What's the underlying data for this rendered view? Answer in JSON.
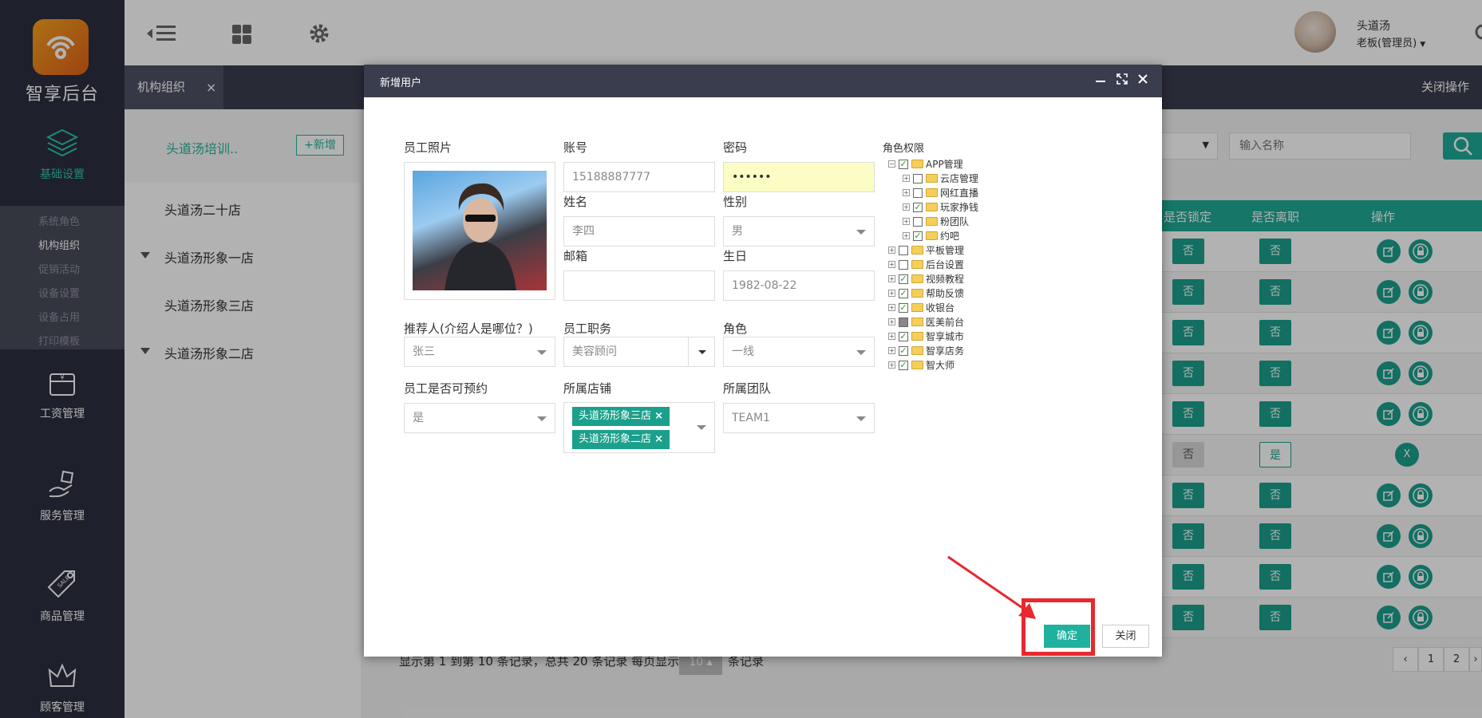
{
  "app": {
    "logo_text": "智享后台"
  },
  "sidebar": {
    "basic_settings": "基础设置",
    "submenu": [
      "系统角色",
      "机构组织",
      "促销活动",
      "设备设置",
      "设备占用",
      "打印模板"
    ],
    "items": [
      "工资管理",
      "服务管理",
      "商品管理",
      "顾客管理"
    ]
  },
  "header": {
    "user_name": "头道汤",
    "user_role": "老板(管理员)"
  },
  "tabs": {
    "org": "机构组织",
    "close_ops": "关闭操作"
  },
  "stores": {
    "title": "头道汤培训..",
    "add": "+新增",
    "list": [
      "头道汤二十店",
      "头道汤形象一店",
      "头道汤形象三店",
      "头道汤形象二店"
    ]
  },
  "search": {
    "placeholder": "输入名称"
  },
  "table": {
    "headers": [
      "是否锁定",
      "是否离职",
      "操作"
    ],
    "rows": [
      {
        "locked": "否",
        "resigned": "否"
      },
      {
        "locked": "否",
        "resigned": "否"
      },
      {
        "locked": "否",
        "resigned": "否"
      },
      {
        "locked": "否",
        "resigned": "否"
      },
      {
        "locked": "否",
        "resigned": "否"
      },
      {
        "locked": "否",
        "resigned": "是",
        "op": "X"
      },
      {
        "locked": "否",
        "resigned": "否"
      },
      {
        "locked": "否",
        "resigned": "否"
      },
      {
        "locked": "否",
        "resigned": "否"
      },
      {
        "locked": "否",
        "resigned": "否"
      }
    ]
  },
  "pager": {
    "text": "显示第 1 到第 10 条记录，总共 20 条记录 每页显示",
    "size": "10",
    "suffix": "条记录",
    "pages": [
      "‹",
      "1",
      "2",
      "›"
    ]
  },
  "modal": {
    "title": "新增用户",
    "photo_label": "员工照片",
    "account_label": "账号",
    "account_value": "15188887777",
    "password_label": "密码",
    "password_value": "••••••",
    "name_label": "姓名",
    "name_value": "李四",
    "gender_label": "性别",
    "gender_value": "男",
    "email_label": "邮箱",
    "email_value": "",
    "birthday_label": "生日",
    "birthday_value": "1982-08-22",
    "referrer_label": "推荐人(介绍人是哪位？)",
    "referrer_value": "张三",
    "position_label": "员工职务",
    "position_value": "美容顾问",
    "role_label": "角色",
    "role_value": "一线",
    "bookable_label": "员工是否可预约",
    "bookable_value": "是",
    "store_label": "所属店铺",
    "store_tags": [
      "头道汤形象三店",
      "头道汤形象二店"
    ],
    "team_label": "所属团队",
    "team_value": "TEAM1",
    "perm_label": "角色权限",
    "tree": [
      {
        "label": "APP管理",
        "level": 0,
        "pm": "−",
        "state": "checked"
      },
      {
        "label": "云店管理",
        "level": 1,
        "pm": "+",
        "state": ""
      },
      {
        "label": "网红直播",
        "level": 1,
        "pm": "+",
        "state": ""
      },
      {
        "label": "玩家挣钱",
        "level": 1,
        "pm": "+",
        "state": "checked"
      },
      {
        "label": "粉团队",
        "level": 1,
        "pm": "+",
        "state": ""
      },
      {
        "label": "约吧",
        "level": 1,
        "pm": "+",
        "state": "checked"
      },
      {
        "label": "平板管理",
        "level": 0,
        "pm": "+",
        "state": ""
      },
      {
        "label": "后台设置",
        "level": 0,
        "pm": "+",
        "state": ""
      },
      {
        "label": "视频教程",
        "level": 0,
        "pm": "+",
        "state": "checked"
      },
      {
        "label": "帮助反馈",
        "level": 0,
        "pm": "+",
        "state": "checked"
      },
      {
        "label": "收银台",
        "level": 0,
        "pm": "+",
        "state": "checked"
      },
      {
        "label": "医美前台",
        "level": 0,
        "pm": "+",
        "state": "part"
      },
      {
        "label": "智享城市",
        "level": 0,
        "pm": "+",
        "state": "checked"
      },
      {
        "label": "智享店务",
        "level": 0,
        "pm": "+",
        "state": "checked"
      },
      {
        "label": "智大师",
        "level": 0,
        "pm": "+",
        "state": "checked"
      }
    ],
    "ok": "确定",
    "close": "关闭"
  },
  "colors": {
    "accent": "#1fab98",
    "dark": "#2c2f3e",
    "highlight": "#e8272e"
  }
}
